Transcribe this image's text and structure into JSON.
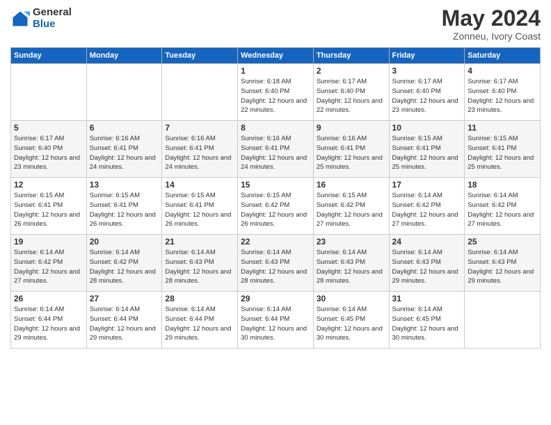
{
  "logo": {
    "general": "General",
    "blue": "Blue"
  },
  "title": "May 2024",
  "subtitle": "Zonneu, Ivory Coast",
  "days_of_week": [
    "Sunday",
    "Monday",
    "Tuesday",
    "Wednesday",
    "Thursday",
    "Friday",
    "Saturday"
  ],
  "weeks": [
    [
      {
        "num": "",
        "info": ""
      },
      {
        "num": "",
        "info": ""
      },
      {
        "num": "",
        "info": ""
      },
      {
        "num": "1",
        "info": "Sunrise: 6:18 AM\nSunset: 6:40 PM\nDaylight: 12 hours\nand 22 minutes."
      },
      {
        "num": "2",
        "info": "Sunrise: 6:17 AM\nSunset: 6:40 PM\nDaylight: 12 hours\nand 22 minutes."
      },
      {
        "num": "3",
        "info": "Sunrise: 6:17 AM\nSunset: 6:40 PM\nDaylight: 12 hours\nand 23 minutes."
      },
      {
        "num": "4",
        "info": "Sunrise: 6:17 AM\nSunset: 6:40 PM\nDaylight: 12 hours\nand 23 minutes."
      }
    ],
    [
      {
        "num": "5",
        "info": "Sunrise: 6:17 AM\nSunset: 6:40 PM\nDaylight: 12 hours\nand 23 minutes."
      },
      {
        "num": "6",
        "info": "Sunrise: 6:16 AM\nSunset: 6:41 PM\nDaylight: 12 hours\nand 24 minutes."
      },
      {
        "num": "7",
        "info": "Sunrise: 6:16 AM\nSunset: 6:41 PM\nDaylight: 12 hours\nand 24 minutes."
      },
      {
        "num": "8",
        "info": "Sunrise: 6:16 AM\nSunset: 6:41 PM\nDaylight: 12 hours\nand 24 minutes."
      },
      {
        "num": "9",
        "info": "Sunrise: 6:16 AM\nSunset: 6:41 PM\nDaylight: 12 hours\nand 25 minutes."
      },
      {
        "num": "10",
        "info": "Sunrise: 6:15 AM\nSunset: 6:41 PM\nDaylight: 12 hours\nand 25 minutes."
      },
      {
        "num": "11",
        "info": "Sunrise: 6:15 AM\nSunset: 6:41 PM\nDaylight: 12 hours\nand 25 minutes."
      }
    ],
    [
      {
        "num": "12",
        "info": "Sunrise: 6:15 AM\nSunset: 6:41 PM\nDaylight: 12 hours\nand 26 minutes."
      },
      {
        "num": "13",
        "info": "Sunrise: 6:15 AM\nSunset: 6:41 PM\nDaylight: 12 hours\nand 26 minutes."
      },
      {
        "num": "14",
        "info": "Sunrise: 6:15 AM\nSunset: 6:41 PM\nDaylight: 12 hours\nand 26 minutes."
      },
      {
        "num": "15",
        "info": "Sunrise: 6:15 AM\nSunset: 6:42 PM\nDaylight: 12 hours\nand 26 minutes."
      },
      {
        "num": "16",
        "info": "Sunrise: 6:15 AM\nSunset: 6:42 PM\nDaylight: 12 hours\nand 27 minutes."
      },
      {
        "num": "17",
        "info": "Sunrise: 6:14 AM\nSunset: 6:42 PM\nDaylight: 12 hours\nand 27 minutes."
      },
      {
        "num": "18",
        "info": "Sunrise: 6:14 AM\nSunset: 6:42 PM\nDaylight: 12 hours\nand 27 minutes."
      }
    ],
    [
      {
        "num": "19",
        "info": "Sunrise: 6:14 AM\nSunset: 6:42 PM\nDaylight: 12 hours\nand 27 minutes."
      },
      {
        "num": "20",
        "info": "Sunrise: 6:14 AM\nSunset: 6:42 PM\nDaylight: 12 hours\nand 28 minutes."
      },
      {
        "num": "21",
        "info": "Sunrise: 6:14 AM\nSunset: 6:43 PM\nDaylight: 12 hours\nand 28 minutes."
      },
      {
        "num": "22",
        "info": "Sunrise: 6:14 AM\nSunset: 6:43 PM\nDaylight: 12 hours\nand 28 minutes."
      },
      {
        "num": "23",
        "info": "Sunrise: 6:14 AM\nSunset: 6:43 PM\nDaylight: 12 hours\nand 28 minutes."
      },
      {
        "num": "24",
        "info": "Sunrise: 6:14 AM\nSunset: 6:43 PM\nDaylight: 12 hours\nand 29 minutes."
      },
      {
        "num": "25",
        "info": "Sunrise: 6:14 AM\nSunset: 6:43 PM\nDaylight: 12 hours\nand 29 minutes."
      }
    ],
    [
      {
        "num": "26",
        "info": "Sunrise: 6:14 AM\nSunset: 6:44 PM\nDaylight: 12 hours\nand 29 minutes."
      },
      {
        "num": "27",
        "info": "Sunrise: 6:14 AM\nSunset: 6:44 PM\nDaylight: 12 hours\nand 29 minutes."
      },
      {
        "num": "28",
        "info": "Sunrise: 6:14 AM\nSunset: 6:44 PM\nDaylight: 12 hours\nand 29 minutes."
      },
      {
        "num": "29",
        "info": "Sunrise: 6:14 AM\nSunset: 6:44 PM\nDaylight: 12 hours\nand 30 minutes."
      },
      {
        "num": "30",
        "info": "Sunrise: 6:14 AM\nSunset: 6:45 PM\nDaylight: 12 hours\nand 30 minutes."
      },
      {
        "num": "31",
        "info": "Sunrise: 6:14 AM\nSunset: 6:45 PM\nDaylight: 12 hours\nand 30 minutes."
      },
      {
        "num": "",
        "info": ""
      }
    ]
  ]
}
